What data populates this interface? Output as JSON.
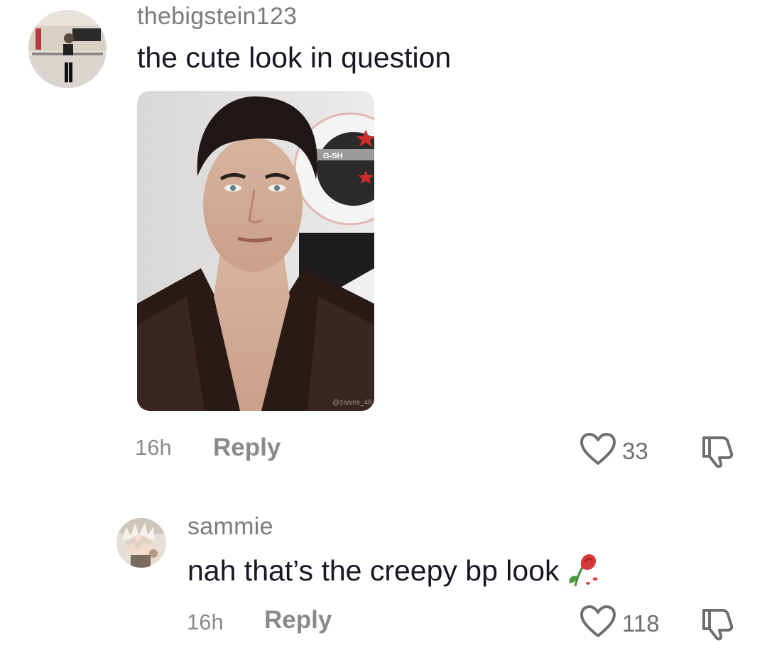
{
  "comments": [
    {
      "username": "thebigstein123",
      "text": "the cute look in question",
      "time": "16h",
      "reply_label": "Reply",
      "like_count": "33",
      "attached_image": {
        "watermark": "@zaains_48",
        "sign_text": "G-SH"
      }
    },
    {
      "username": "sammie",
      "text": "nah that’s the creepy bp look",
      "emoji": "🥀",
      "time": "16h",
      "reply_label": "Reply",
      "like_count": "118"
    }
  ],
  "icons": {
    "like": "heart-outline-icon",
    "dislike": "thumbs-down-icon",
    "emoji": "wilted-rose-icon"
  },
  "colors": {
    "text": "#161823",
    "muted": "#8a8a8e",
    "username": "#7b7b80"
  }
}
